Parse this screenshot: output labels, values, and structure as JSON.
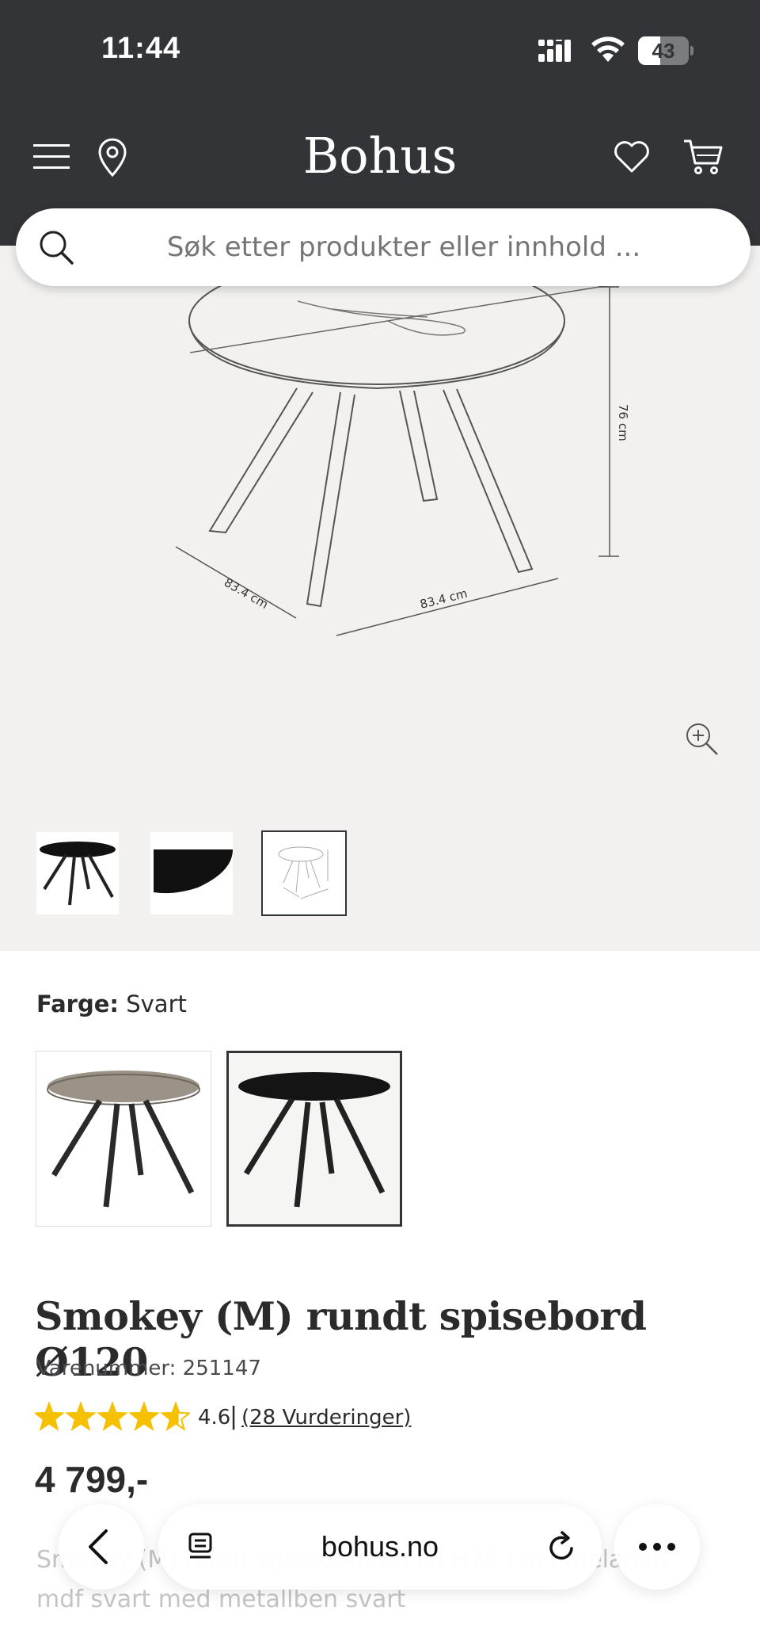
{
  "status_bar": {
    "time": "11:44",
    "battery_percent": "43",
    "battery_level": 0.43,
    "icons": [
      "cellular-signal-icon",
      "wifi-icon",
      "battery-icon"
    ]
  },
  "header": {
    "logo": "Bohus",
    "icons": [
      "menu-icon",
      "location-pin-icon",
      "heart-icon",
      "cart-icon"
    ],
    "background": "#333438"
  },
  "search": {
    "placeholder": "Søk etter produkter eller innhold ..."
  },
  "gallery": {
    "dimension_labels": {
      "height": "76 cm",
      "depth": "83.4 cm",
      "width": "83.4 cm"
    },
    "thumbnails": [
      {
        "name": "black-table-thumbnail",
        "selected": false
      },
      {
        "name": "tabletop-edge-thumbnail",
        "selected": false
      },
      {
        "name": "dimension-sketch-thumbnail",
        "selected": true
      }
    ]
  },
  "color": {
    "label": "Farge:",
    "value": "Svart",
    "options": [
      {
        "name": "oak-table-swatch",
        "top_color": "#9b9388",
        "selected": false
      },
      {
        "name": "black-table-swatch",
        "top_color": "#141414",
        "selected": true
      }
    ]
  },
  "product": {
    "title": "Smokey (M) rundt spisebord Ø120",
    "sku": "Varenummer: 251147",
    "rating": 4.6,
    "rating_text": "4.6",
    "rating_separator": "|",
    "reviews": "(28 Vurderinger)",
    "price": "4 799,-",
    "description": "Smokey (M) rundt spisebord Ø120 H76 cm i melamin mdf svart med metallben svart",
    "star_color": "#f4c000"
  },
  "browser": {
    "url": "bohus.no",
    "icons": [
      "back-icon",
      "tabs-icon",
      "reload-icon",
      "more-icon"
    ]
  }
}
